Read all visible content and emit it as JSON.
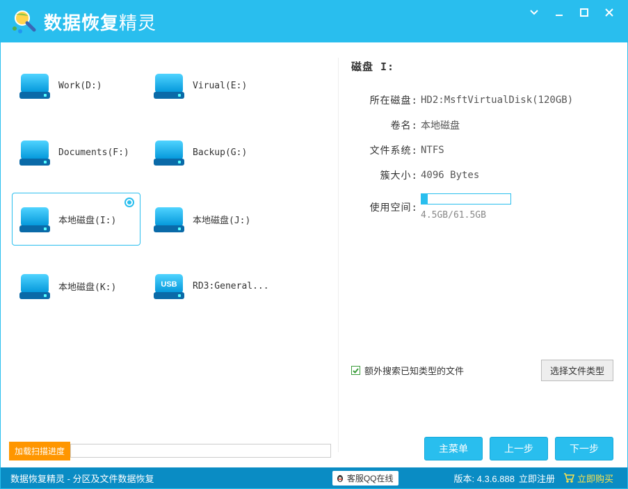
{
  "header": {
    "app_title_main": "数据恢复",
    "app_title_sub": "精灵"
  },
  "drives": [
    {
      "label": "Work(D:)",
      "type": "hdd"
    },
    {
      "label": "Virual(E:)",
      "type": "hdd"
    },
    {
      "label": "Documents(F:)",
      "type": "hdd"
    },
    {
      "label": "Backup(G:)",
      "type": "hdd"
    },
    {
      "label": "本地磁盘(I:)",
      "type": "hdd",
      "selected": true
    },
    {
      "label": "本地磁盘(J:)",
      "type": "hdd"
    },
    {
      "label": "本地磁盘(K:)",
      "type": "hdd"
    },
    {
      "label": "RD3:General...",
      "type": "usb"
    }
  ],
  "progress": {
    "load_label": "加载扫描进度"
  },
  "details": {
    "heading": "磁盘 I:",
    "rows": {
      "disk_label": "所在磁盘:",
      "disk_value": "HD2:MsftVirtualDisk(120GB)",
      "volume_label": "卷名:",
      "volume_value": "本地磁盘",
      "fs_label": "文件系统:",
      "fs_value": "NTFS",
      "cluster_label": "簇大小:",
      "cluster_value": "4096 Bytes",
      "usage_label": "使用空间:",
      "usage_text": "4.5GB/61.5GB",
      "usage_percent": 7
    },
    "extra_search_label": "额外搜索已知类型的文件",
    "select_type_label": "选择文件类型"
  },
  "nav": {
    "menu": "主菜单",
    "prev": "上一步",
    "next": "下一步"
  },
  "footer": {
    "status": "数据恢复精灵 - 分区及文件数据恢复",
    "qq_label": "客服QQ在线",
    "version_prefix": "版本: ",
    "version": "4.3.6.888",
    "register": "立即注册",
    "buy": "立即购买"
  }
}
